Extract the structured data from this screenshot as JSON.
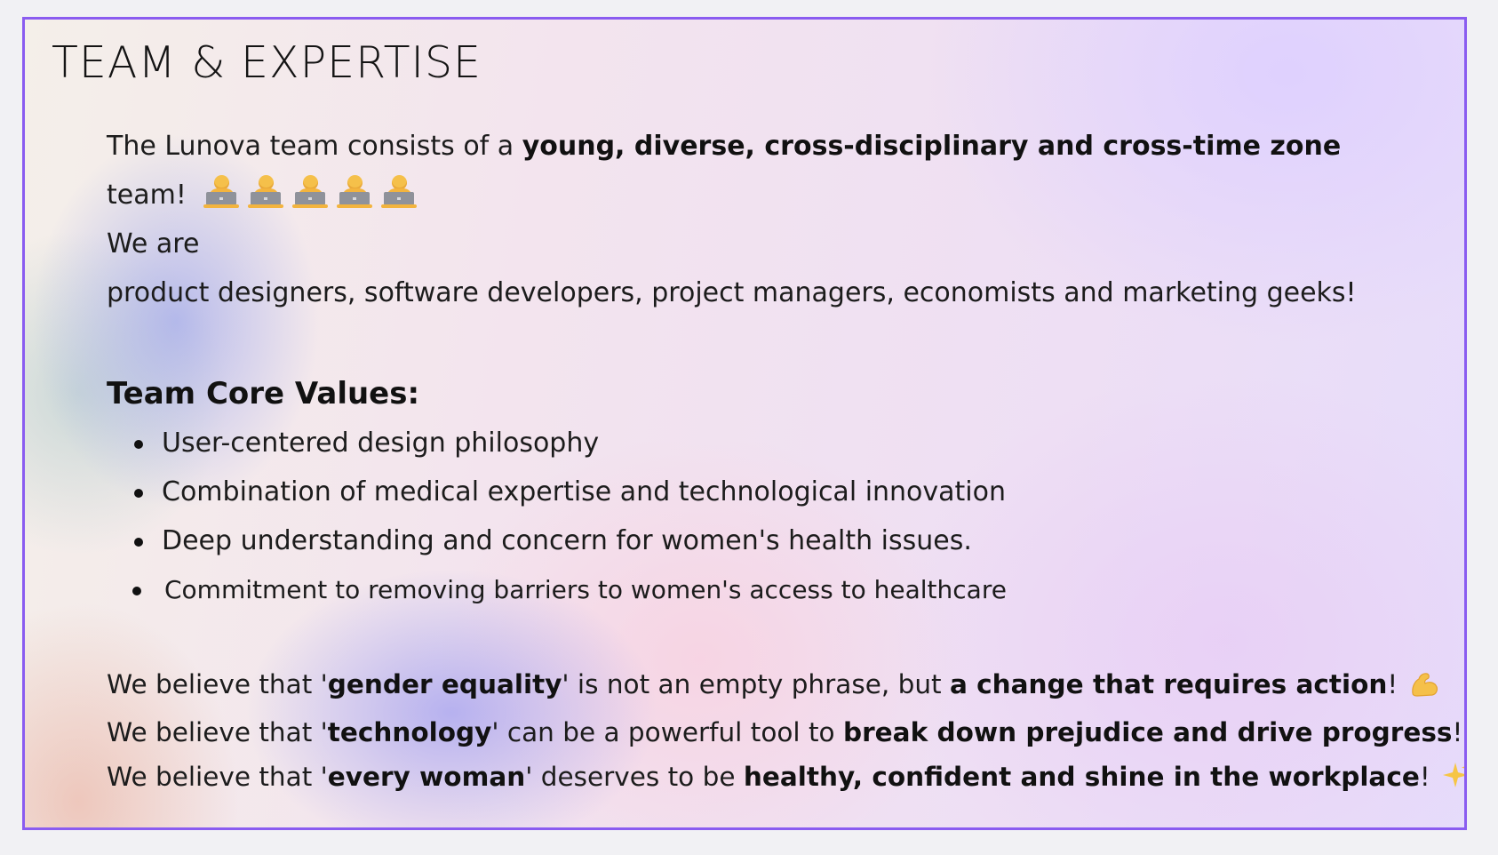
{
  "title": "TEAM & EXPERTISE",
  "intro": {
    "line1_prefix": "The Lunova team consists of a ",
    "line1_bold": "young, diverse, cross-disciplinary and cross-time zone",
    "line2_text": "team! ",
    "emoji_icons": [
      "person-with-laptop-icon",
      "person-with-laptop-icon",
      "person-with-laptop-icon",
      "person-with-laptop-icon",
      "person-with-laptop-icon"
    ],
    "line3": "We are",
    "line4": "product designers, software developers, project managers, economists and marketing geeks!"
  },
  "core_values": {
    "heading": "Team Core Values:",
    "items": [
      "User-centered design philosophy",
      "Combination of medical expertise and technological innovation",
      "Deep understanding and concern for women's health issues.",
      "Commitment to removing barriers to women's access to healthcare"
    ]
  },
  "beliefs": [
    {
      "prefix": "We believe that '",
      "bold1": "gender equality",
      "middle": "' is not an empty phrase, but ",
      "bold2": "a change that requires action",
      "suffix": "!",
      "icon": "flexed-biceps-icon"
    },
    {
      "prefix": "We believe that '",
      "bold1": "technology",
      "middle": "' can be a powerful tool to ",
      "bold2": "break down prejudice and drive progress",
      "suffix": "!",
      "icon": ""
    },
    {
      "prefix": "We believe that '",
      "bold1": "every woman",
      "middle": "' deserves to be ",
      "bold2": "healthy, confident and shine in the workplace",
      "suffix": "!",
      "icon": "sparkles-icon"
    }
  ],
  "colors": {
    "border": "#8a5cf0",
    "text": "#1c1c1c",
    "emoji_yellow": "#f5c04a"
  }
}
